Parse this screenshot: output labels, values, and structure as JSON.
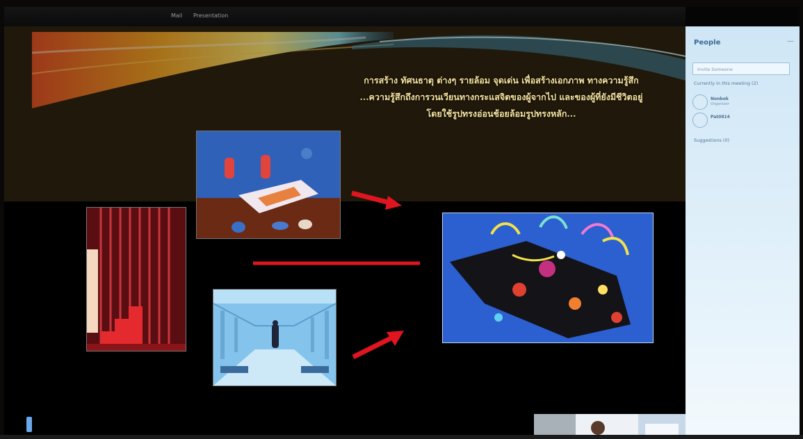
{
  "window": {
    "menu": [
      "Mail",
      "Presentation"
    ]
  },
  "slide": {
    "title_lines": [
      "การสร้าง ทัศนธาตุ ต่างๆ รายล้อม จุดเด่น เพื่อสร้างเอกภาพ ทางความรู้สึก",
      "...ความรู้สึกถึงการวนเวียนทางกระแสจิตของผู้จากไป และของผู้ที่ยังมีชีวิตอยู่",
      "โดยใช้รูปทรงอ่อนช้อยล้อมรูปทรงหลัก..."
    ]
  },
  "sidebar": {
    "header": "People",
    "close": "—",
    "invite_placeholder": "Invite Someone",
    "in_meeting": "Currently in this meeting (2)",
    "participants": [
      {
        "name": "Nonbok",
        "status": "Organizer"
      },
      {
        "name": "Pat0814",
        "status": ""
      }
    ],
    "suggestions": "Suggestions (0)"
  },
  "colors": {
    "accent_red": "#e0151f",
    "title_text": "#f6e3a0",
    "sidebar_bg": "#d9ecf8"
  }
}
